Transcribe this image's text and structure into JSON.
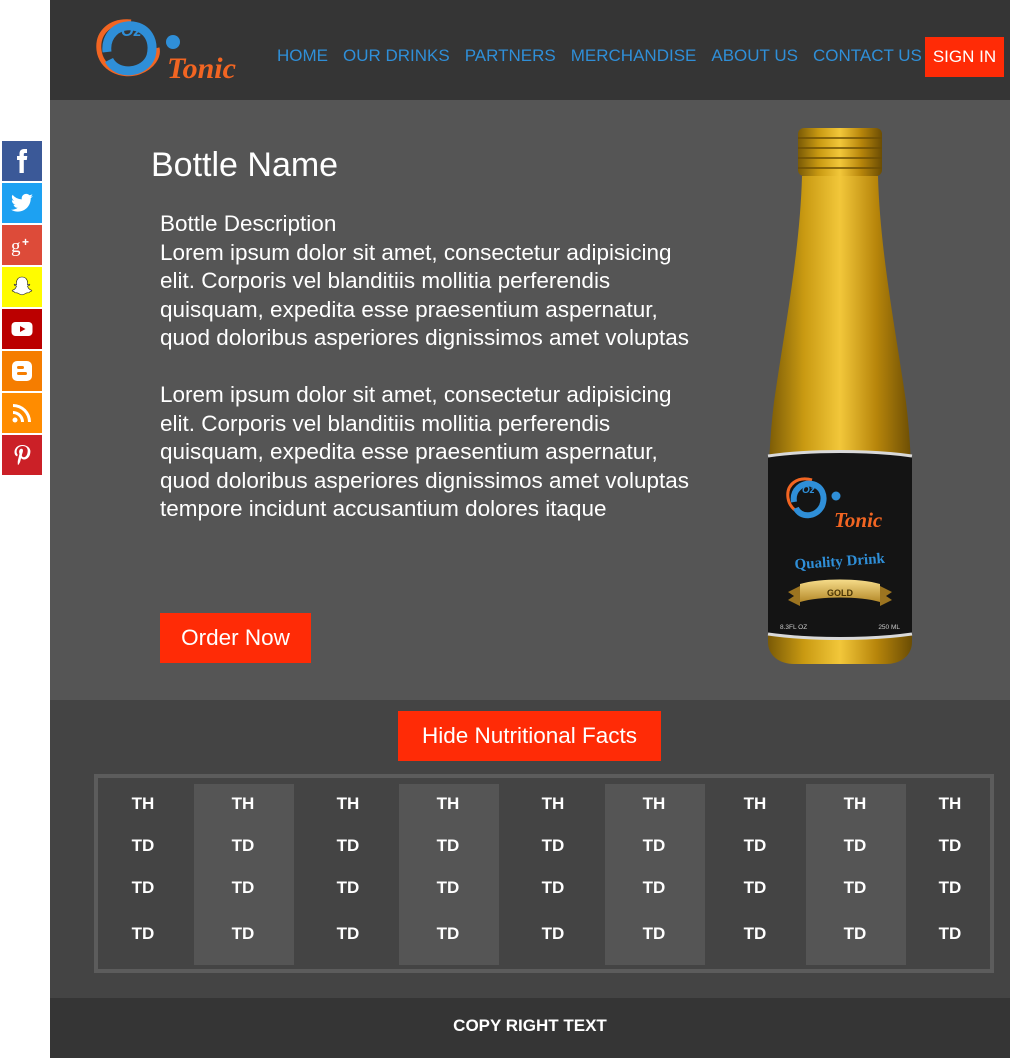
{
  "brand": {
    "logo_top": "Oz",
    "logo_main": "Tonic"
  },
  "nav": {
    "items": [
      {
        "label": "HOME"
      },
      {
        "label": "OUR DRINKS"
      },
      {
        "label": "PARTNERS"
      },
      {
        "label": "MERCHANDISE"
      },
      {
        "label": "ABOUT US"
      },
      {
        "label": "CONTACT US"
      }
    ],
    "signin_label": "SIGN IN"
  },
  "social": {
    "items": [
      {
        "icon": "facebook-icon",
        "color": "#3b5998"
      },
      {
        "icon": "twitter-icon",
        "color": "#1da1f2"
      },
      {
        "icon": "google-plus-icon",
        "color": "#dd4b39"
      },
      {
        "icon": "snapchat-icon",
        "color": "#fffc00"
      },
      {
        "icon": "youtube-icon",
        "color": "#bb0000"
      },
      {
        "icon": "blogger-icon",
        "color": "#f57d00"
      },
      {
        "icon": "rss-icon",
        "color": "#ff8c00"
      },
      {
        "icon": "pinterest-icon",
        "color": "#cb2027"
      }
    ]
  },
  "product": {
    "title": "Bottle Name",
    "description_heading": "Bottle Description",
    "paragraph_1": "Lorem ipsum dolor sit amet, consectetur adipisicing elit. Corporis vel blanditiis mollitia perferendis quisquam, expedita esse praesentium aspernatur, quod doloribus asperiores dignissimos amet voluptas",
    "paragraph_2": "Lorem ipsum dolor sit amet, consectetur adipisicing elit. Corporis vel blanditiis mollitia perferendis quisquam, expedita esse praesentium aspernatur, quod doloribus asperiores dignissimos amet voluptas tempore incidunt accusantium dolores itaque",
    "order_label": "Order Now",
    "bottle_label": {
      "brand_top": "Oz",
      "brand_main": "Tonic",
      "tagline": "Quality Drink",
      "ribbon": "GOLD",
      "left_small": "8.3FL OZ",
      "right_small": "250 ML"
    }
  },
  "nutrition": {
    "toggle_label": "Hide Nutritional Facts",
    "headers": [
      "TH",
      "TH",
      "TH",
      "TH",
      "TH",
      "TH",
      "TH",
      "TH",
      "TH"
    ],
    "rows": [
      [
        "TD",
        "TD",
        "TD",
        "TD",
        "TD",
        "TD",
        "TD",
        "TD",
        "TD"
      ],
      [
        "TD",
        "TD",
        "TD",
        "TD",
        "TD",
        "TD",
        "TD",
        "TD",
        "TD"
      ],
      [
        "TD",
        "TD",
        "TD",
        "TD",
        "TD",
        "TD",
        "TD",
        "TD",
        "TD"
      ]
    ]
  },
  "footer": {
    "copyright": "COPY RIGHT TEXT"
  },
  "colors": {
    "accent": "#ff2b06",
    "nav_link": "#2f8fd8",
    "header_bg": "#353535",
    "content_bg": "#555555"
  }
}
